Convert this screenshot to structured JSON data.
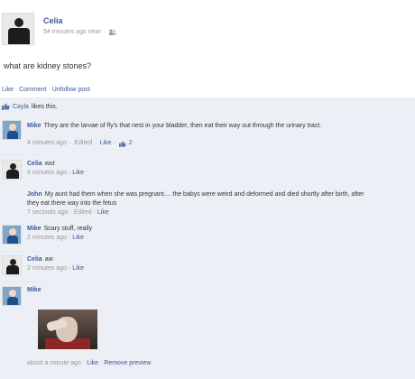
{
  "post": {
    "author": "Celia",
    "time": "54 minutes ago near",
    "separator": "·",
    "text": "what are kidney stones?",
    "actions": [
      "Like",
      "Comment",
      "Unfollow post"
    ]
  },
  "likes": {
    "name": "Cayla",
    "text": "likes this."
  },
  "comments": [
    {
      "author": "Mike",
      "text": "They are the larvae of fly's that nest in your bladder, then eat their way out through the urinary tract.",
      "time": "4 minutes ago",
      "edited": "Edited",
      "like": "Like",
      "like_count": "2"
    },
    {
      "author": "Celia",
      "text": "wut",
      "time": "4 minutes ago",
      "like": "Like"
    },
    {
      "author": "John",
      "text": "My aunt had them when she was pregnant.... the babys were weird and deformed and died shortly after birth, after they eat there way into the fetus",
      "time": "7 seconds ago",
      "edited": "Edited",
      "like": "Like"
    },
    {
      "author": "Mike",
      "text": "Scary stuff, really",
      "time": "2 minutes ago",
      "like": "Like"
    },
    {
      "author": "Celia",
      "text": "aw",
      "time": "2 minutes ago",
      "like": "Like"
    },
    {
      "author": "Mike",
      "text": "",
      "time": "about a minute ago",
      "like": "Like",
      "remove_preview": "Remove preview"
    }
  ],
  "icons": {
    "like": "thumbs-up-icon",
    "friends": "friends-icon"
  },
  "colors": {
    "link": "#3b5998",
    "feedback_bg": "#eceff5",
    "meta": "#999999"
  }
}
